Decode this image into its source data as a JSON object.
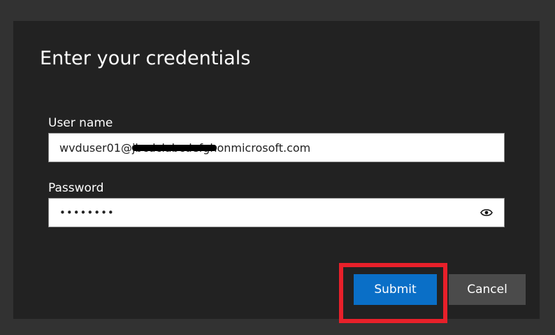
{
  "dialog": {
    "title": "Enter your credentials",
    "username": {
      "label": "User name",
      "value_prefix": "wvduser01@",
      "value_redacted": "jbcdclabcdefgh",
      "value_suffix": "onmicrosoft.com"
    },
    "password": {
      "label": "Password",
      "value": "••••••••",
      "reveal_icon": "eye-icon"
    },
    "buttons": {
      "submit": "Submit",
      "cancel": "Cancel"
    }
  },
  "colors": {
    "background": "#323232",
    "dialog": "#222222",
    "submit": "#0a6fc7",
    "cancel": "#4b4b4b",
    "highlight": "#e8202a"
  }
}
